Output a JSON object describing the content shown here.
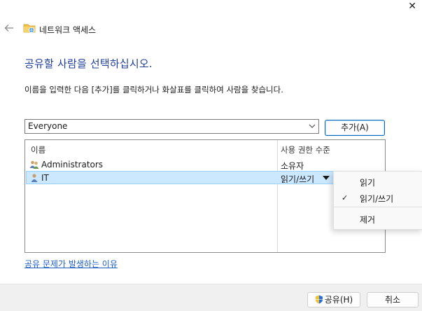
{
  "window": {
    "title": "네트워크 액세스",
    "close_glyph": "✕"
  },
  "heading": "공유할 사람을 선택하십시오.",
  "description": "이름을 입력한 다음 [추가]를 클릭하거나 화살표를 클릭하여 사람을 찾습니다.",
  "combo": {
    "value": "Everyone"
  },
  "add_button": "추가(A)",
  "list": {
    "columns": [
      "이름",
      "사용 권한 수준"
    ],
    "rows": [
      {
        "name": "Administrators",
        "permission": "소유자",
        "icon": "users-group-icon"
      },
      {
        "name": "IT",
        "permission": "읽기/쓰기",
        "icon": "user-icon",
        "selected": true
      }
    ]
  },
  "permission_menu": {
    "items": [
      "읽기",
      "읽기/쓰기",
      "제거"
    ],
    "checked": "읽기/쓰기",
    "check_glyph": "✓"
  },
  "help_link": "공유 문제가 발생하는 이유",
  "footer": {
    "share_button": "공유(H)",
    "cancel_button": "취소"
  },
  "colors": {
    "heading": "#1f3f9a",
    "selection": "#cce8ff",
    "link": "#1f5fbf",
    "accent": "#0067c0"
  }
}
